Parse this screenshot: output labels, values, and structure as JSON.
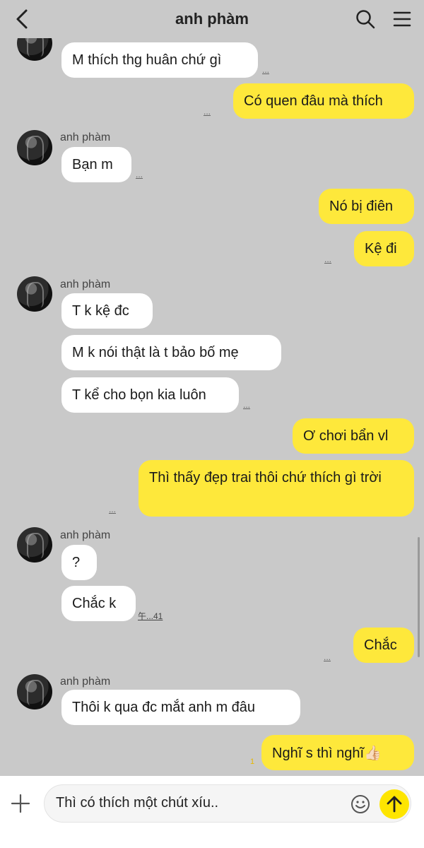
{
  "header": {
    "title": "anh phàm",
    "back_icon": "chevron-left-icon",
    "search_icon": "search-icon",
    "menu_icon": "menu-icon"
  },
  "contact_name": "anh phàm",
  "messages": {
    "m1": "M thích thg huân chứ gì",
    "m1_meta": "...",
    "m2": "Có quen đâu mà thích",
    "m2_meta": "...",
    "m3": "Bạn m",
    "m3_meta": "...",
    "m4": "Nó bị điên",
    "m5": "Kệ đi",
    "m5_meta": "...",
    "m6": "T k kệ đc",
    "m7": "M k nói thật là t bảo bố mẹ",
    "m8": "T kể cho bọn kia luôn",
    "m8_meta": "...",
    "m9": "Ơ chơi bẩn vl",
    "m10": "Thì thấy đẹp trai thôi chứ thích gì trời",
    "m10_meta": "...",
    "m11": "?",
    "m12": "Chắc k",
    "m12_time": "午...41",
    "m13": "Chắc",
    "m13_meta": "...",
    "m14": "Thôi k qua đc mắt anh m đâu",
    "m15": "Nghĩ s thì nghĩ👍🏻",
    "m15_unread": "1"
  },
  "input": {
    "value": "Thì có thích một chút xíu..",
    "plus_icon": "plus-icon",
    "emoji_icon": "emoji-icon",
    "send_icon": "send-arrow-icon"
  },
  "colors": {
    "background": "#c9c9c9",
    "outgoing_bubble": "#fee83b",
    "incoming_bubble": "#ffffff",
    "send_button": "#fee500"
  }
}
